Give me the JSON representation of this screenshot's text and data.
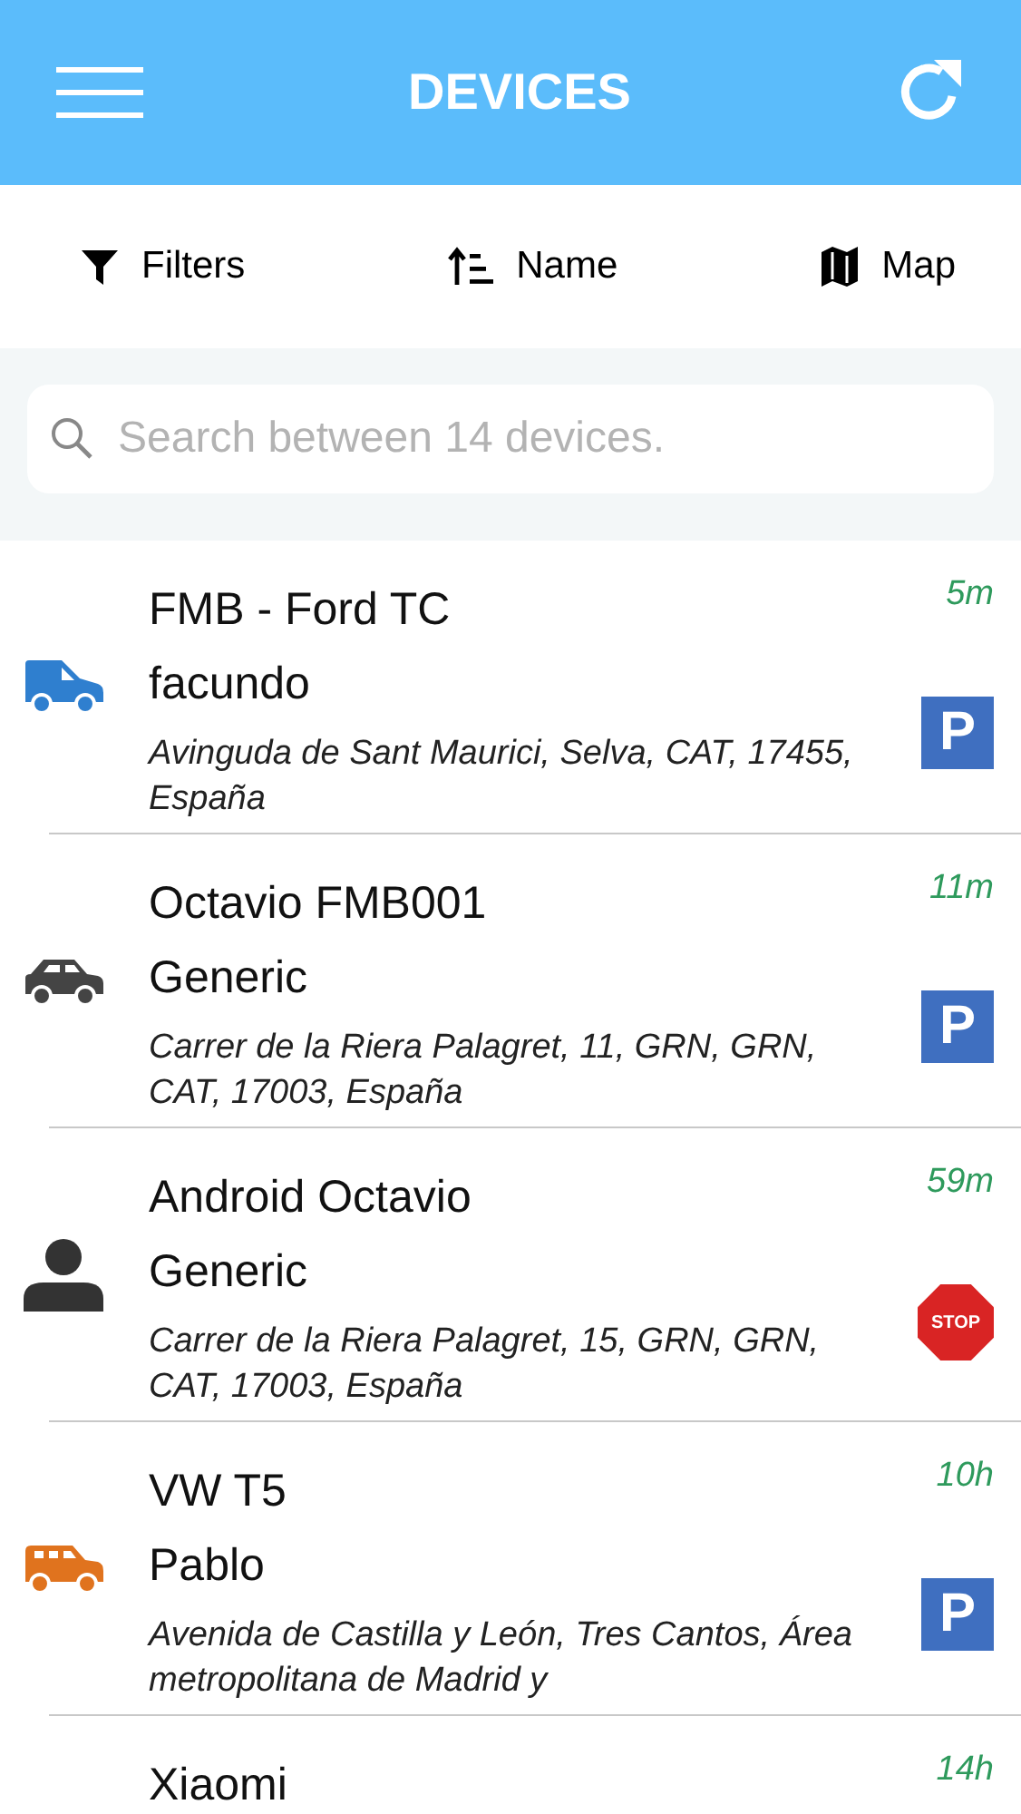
{
  "header": {
    "title": "DEVICES"
  },
  "toolbar": [
    {
      "kind": "filter",
      "label": "Filters"
    },
    {
      "kind": "sort",
      "label": "Name"
    },
    {
      "kind": "map",
      "label": "Map"
    }
  ],
  "search": {
    "placeholder": "Search between 14 devices."
  },
  "devices": [
    {
      "name": "FMB - Ford TC",
      "driver": "facundo",
      "address": "Avinguda de Sant Maurici, Selva, CAT, 17455, España",
      "time": "5m",
      "icon": {
        "kind": "van",
        "color": "#2f7fcf"
      },
      "status": {
        "kind": "parked",
        "label": "P"
      }
    },
    {
      "name": "Octavio FMB001",
      "driver": "Generic",
      "address": "Carrer de la Riera Palagret, 11, GRN, GRN, CAT, 17003, España",
      "time": "11m",
      "icon": {
        "kind": "car",
        "color": "#444444"
      },
      "status": {
        "kind": "parked",
        "label": "P"
      }
    },
    {
      "name": "Android Octavio",
      "driver": "Generic",
      "address": "Carrer de la Riera Palagret, 15, GRN, GRN, CAT, 17003, España",
      "time": "59m",
      "icon": {
        "kind": "person",
        "color": "#333333"
      },
      "status": {
        "kind": "stopped",
        "label": "STOP"
      }
    },
    {
      "name": "VW T5",
      "driver": "Pablo",
      "address": "Avenida de Castilla y León, Tres Cantos, Área metropolitana de Madrid y",
      "time": "10h",
      "icon": {
        "kind": "suv",
        "color": "#e0731e"
      },
      "status": {
        "kind": "parked",
        "label": "P"
      }
    },
    {
      "name": "Xiaomi",
      "time": "14h"
    }
  ]
}
